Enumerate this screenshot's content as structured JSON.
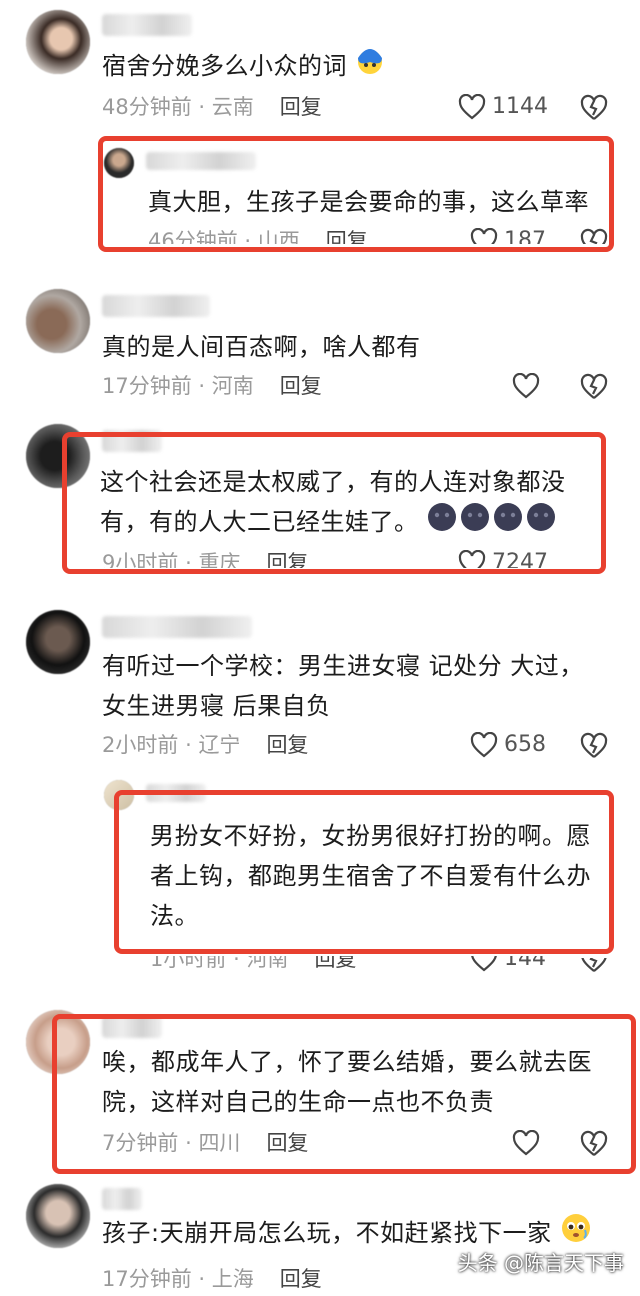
{
  "comments": [
    {
      "text": "宿舍分娩多么小众的词",
      "time": "48分钟前",
      "location": "云南",
      "reply": "回复",
      "likes": "1144"
    },
    {
      "text": "真大胆，生孩子是会要命的事，这么草率",
      "time": "46分钟前",
      "location": "山西",
      "reply": "回复",
      "likes": "187"
    },
    {
      "text": "真的是人间百态啊，啥人都有",
      "time": "17分钟前",
      "location": "河南",
      "reply": "回复",
      "likes": ""
    },
    {
      "text1": "这个社会还是太权威了，有的人连对象都没",
      "text2": "有，有的人大二已经生娃了。",
      "time": "9小时前",
      "location": "重庆",
      "reply": "回复",
      "likes": "7247"
    },
    {
      "text1": "有听过一个学校：男生进女寝  记处分 大过，",
      "text2": "女生进男寝 后果自负",
      "time": "2小时前",
      "location": "辽宁",
      "reply": "回复",
      "likes": "658"
    },
    {
      "text1": "男扮女不好扮，女扮男很好打扮的啊。愿",
      "text2": "者上钩，都跑男生宿舍了不自爱有什么办",
      "text3": "法。",
      "time": "1小时前",
      "location": "河南",
      "reply": "回复",
      "likes": "144"
    },
    {
      "text1": "唉，都成年人了，怀了要么结婚，要么就去医",
      "text2": "院，这样对自己的生命一点也不负责",
      "time": "7分钟前",
      "location": "四川",
      "reply": "回复",
      "likes": ""
    },
    {
      "text": "孩子:天崩开局怎么玩，不如赶紧找下一家",
      "time": "17分钟前",
      "location": "上海",
      "reply": "回复",
      "likes": ""
    }
  ],
  "separator": "·",
  "watermark": "头条 @陈言天下事",
  "colors": {
    "highlight": "#e8402f",
    "meta": "#9a9a9a"
  }
}
